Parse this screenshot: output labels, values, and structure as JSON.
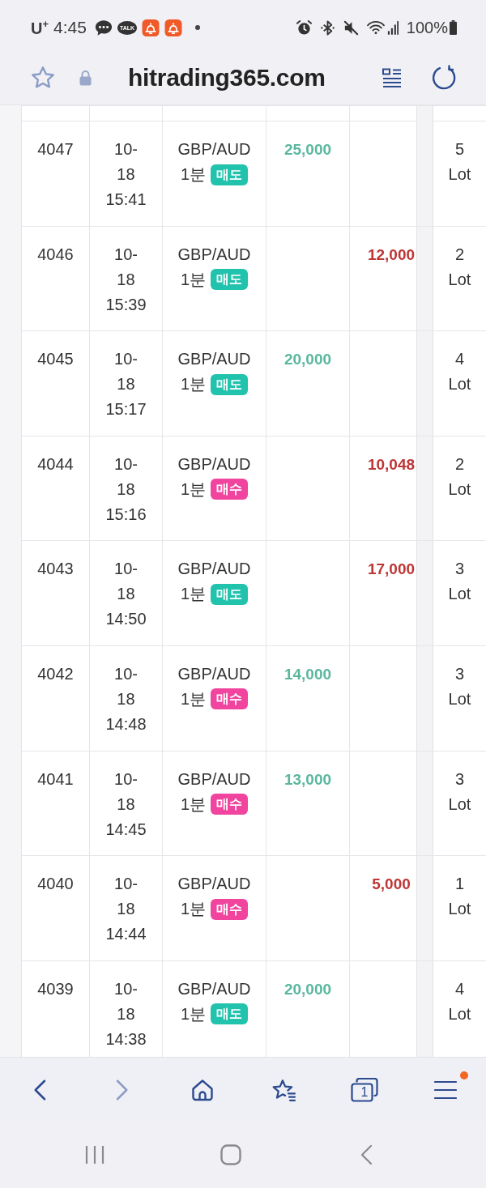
{
  "status_bar": {
    "carrier": "U$^{+}$",
    "time": "4:45",
    "talk_label": "TALK",
    "battery_text": "100%"
  },
  "address_bar": {
    "url": "hitrading365.com"
  },
  "table": {
    "rows": [
      {
        "number": "4047",
        "datetime": "10-18 15:41",
        "pair": "GBP/AUD",
        "interval": "1분",
        "badge": {
          "label": "매도",
          "color": "#22c3ad"
        },
        "profit": "25,000",
        "lots": "5 Lot"
      },
      {
        "number": "4046",
        "datetime": "10-18 15:39",
        "pair": "GBP/AUD",
        "interval": "1분",
        "badge": {
          "label": "매도",
          "color": "#22c3ad"
        },
        "loss": "12,000",
        "lots": "2 Lot"
      },
      {
        "number": "4045",
        "datetime": "10-18 15:17",
        "pair": "GBP/AUD",
        "interval": "1분",
        "badge": {
          "label": "매도",
          "color": "#22c3ad"
        },
        "profit": "20,000",
        "lots": "4 Lot"
      },
      {
        "number": "4044",
        "datetime": "10-18 15:16",
        "pair": "GBP/AUD",
        "interval": "1분",
        "badge": {
          "label": "매수",
          "color": "#f0449e"
        },
        "loss": "10,048",
        "lots": "2 Lot"
      },
      {
        "number": "4043",
        "datetime": "10-18 14:50",
        "pair": "GBP/AUD",
        "interval": "1분",
        "badge": {
          "label": "매도",
          "color": "#22c3ad"
        },
        "loss": "17,000",
        "lots": "3 Lot"
      },
      {
        "number": "4042",
        "datetime": "10-18 14:48",
        "pair": "GBP/AUD",
        "interval": "1분",
        "badge": {
          "label": "매수",
          "color": "#f0449e"
        },
        "profit": "14,000",
        "lots": "3 Lot"
      },
      {
        "number": "4041",
        "datetime": "10-18 14:45",
        "pair": "GBP/AUD",
        "interval": "1분",
        "badge": {
          "label": "매수",
          "color": "#f0449e"
        },
        "profit": "13,000",
        "lots": "3 Lot"
      },
      {
        "number": "4040",
        "datetime": "10-18 14:44",
        "pair": "GBP/AUD",
        "interval": "1분",
        "badge": {
          "label": "매수",
          "color": "#f0449e"
        },
        "loss": "5,000",
        "lots": "1 Lot"
      },
      {
        "number": "4039",
        "datetime": "10-18 14:38",
        "pair": "GBP/AUD",
        "interval": "1분",
        "badge": {
          "label": "매도",
          "color": "#22c3ad"
        },
        "profit": "20,000",
        "lots": "4 Lot"
      }
    ]
  },
  "bottom_toolbar": {
    "back": {
      "disabled": false
    },
    "forward": {
      "disabled": true
    },
    "tab_count": "1",
    "menu": {
      "badge": true
    }
  }
}
